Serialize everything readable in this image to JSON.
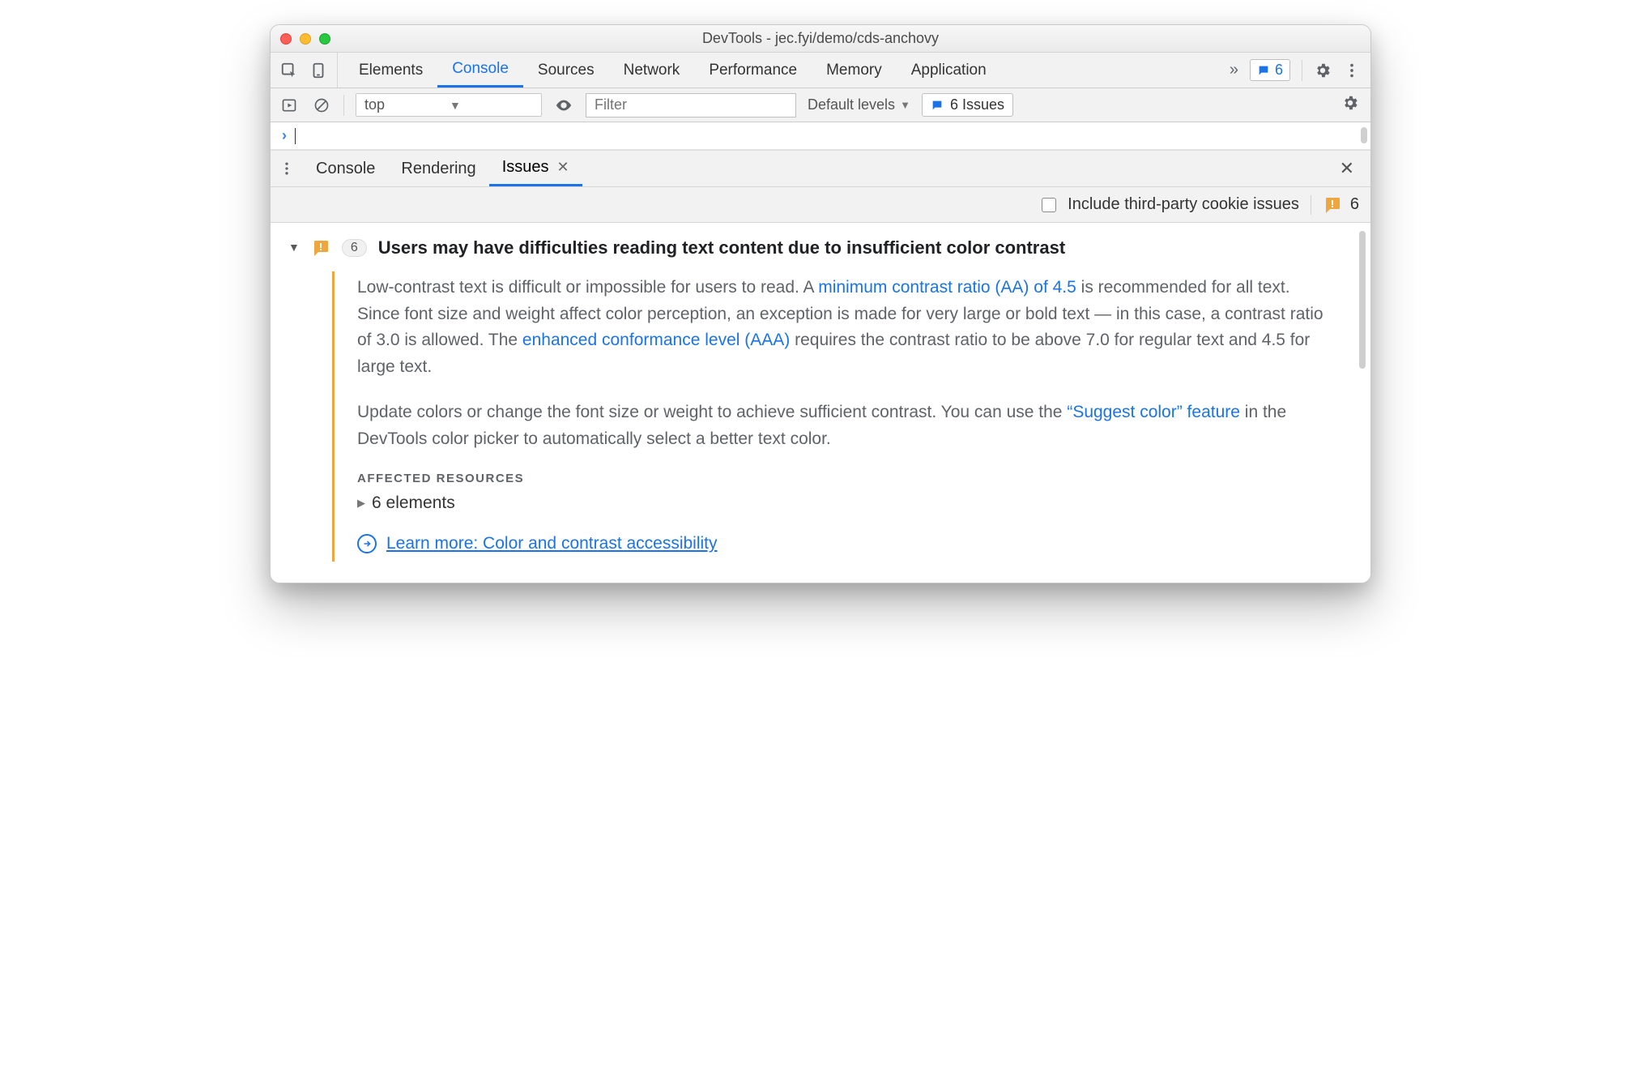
{
  "window": {
    "title": "DevTools - jec.fyi/demo/cds-anchovy"
  },
  "mainTabs": {
    "items": [
      "Elements",
      "Console",
      "Sources",
      "Network",
      "Performance",
      "Memory",
      "Application"
    ],
    "activeIndex": 1,
    "issuesBadge": "6"
  },
  "consoleToolbar": {
    "context": "top",
    "filterPlaceholder": "Filter",
    "levels": "Default levels",
    "issuesLabel": "6 Issues"
  },
  "drawerTabs": {
    "items": [
      "Console",
      "Rendering",
      "Issues"
    ],
    "activeIndex": 2
  },
  "drawerToolbar": {
    "includeLabel": "Include third-party cookie issues",
    "count": "6"
  },
  "issue": {
    "count": "6",
    "title": "Users may have difficulties reading text content due to insufficient color contrast",
    "p1a": "Low-contrast text is difficult or impossible for users to read. A ",
    "link1": "minimum contrast ratio (AA) of 4.5",
    "p1b": " is recommended for all text. Since font size and weight affect color perception, an exception is made for very large or bold text — in this case, a contrast ratio of 3.0 is allowed. The ",
    "link2": "enhanced conformance level (AAA)",
    "p1c": " requires the contrast ratio to be above 7.0 for regular text and 4.5 for large text.",
    "p2a": "Update colors or change the font size or weight to achieve sufficient contrast. You can use the ",
    "link3": "“Suggest color” feature",
    "p2b": " in the DevTools color picker to automatically select a better text color.",
    "affectedHeading": "AFFECTED RESOURCES",
    "affectedRow": "6 elements",
    "learnMore": "Learn more: Color and contrast accessibility"
  }
}
